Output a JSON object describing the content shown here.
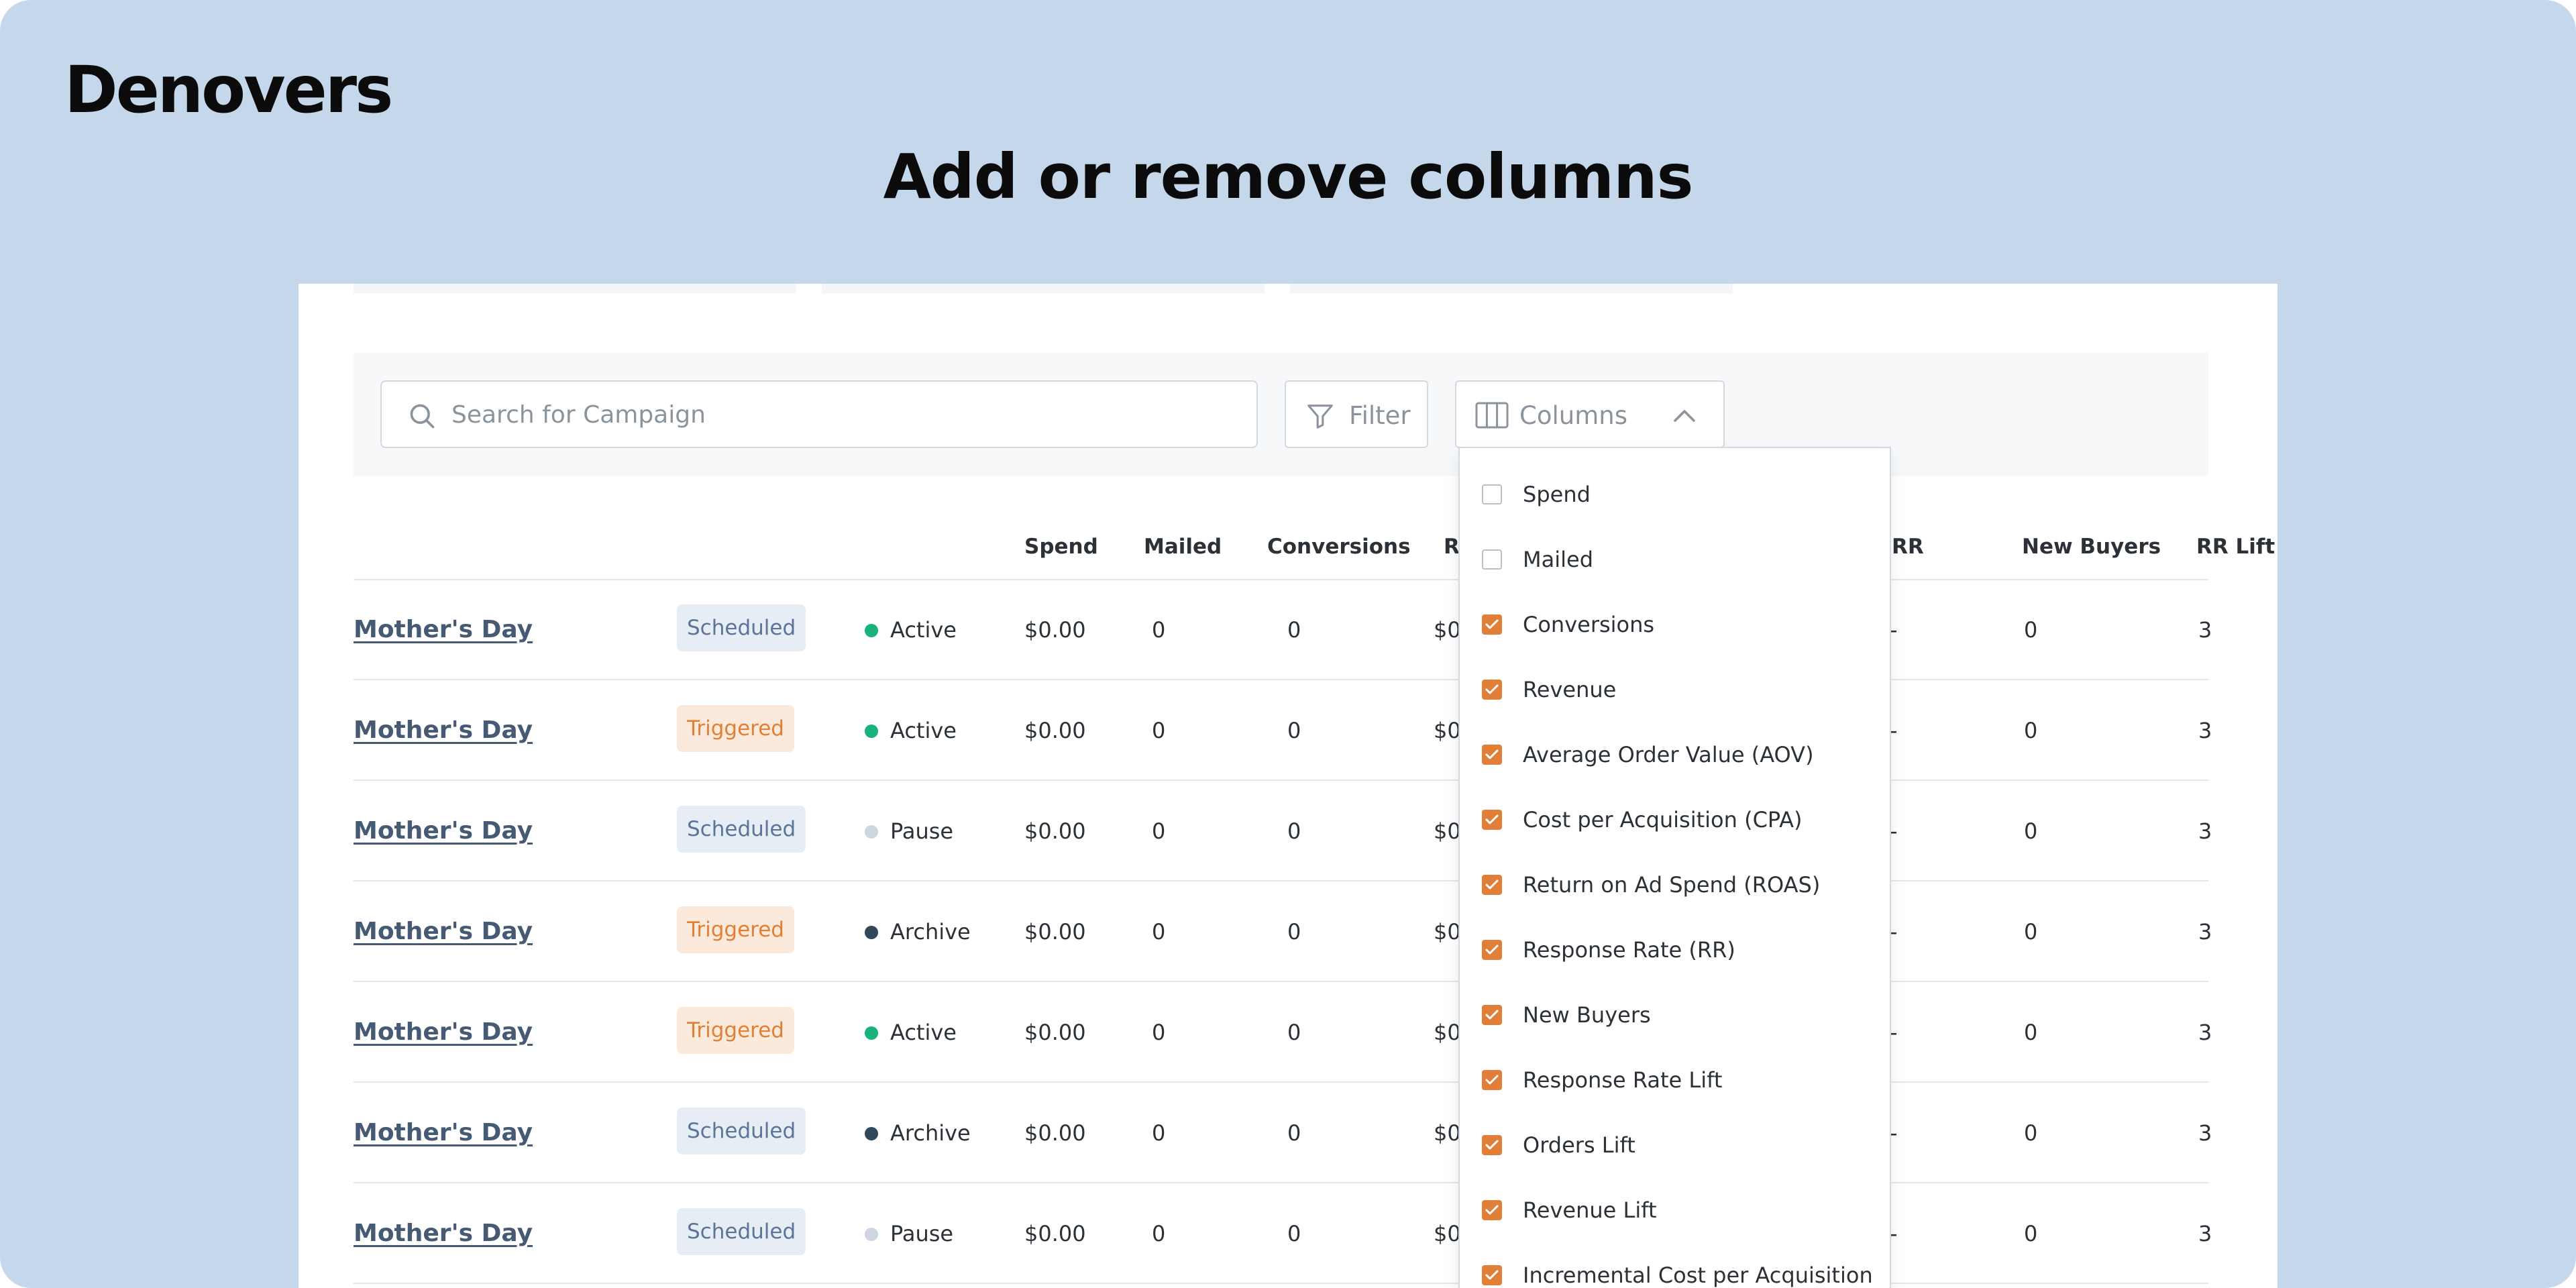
{
  "brand": {
    "logo_text": "Denovers"
  },
  "headline": "Add or remove columns",
  "toolbar": {
    "search_placeholder": "Search for Campaign",
    "filter_label": "Filter",
    "columns_label": "Columns"
  },
  "table": {
    "headers": [
      "Spend",
      "Mailed",
      "Conversions",
      "R",
      "RR",
      "New Buyers",
      "RR Lift"
    ],
    "rows": [
      {
        "name": "Mother's Day",
        "type": "Scheduled",
        "status": "Active",
        "spend": "$0.00",
        "mailed": "0",
        "conversions": "0",
        "revenue": "$0",
        "rr": "-",
        "new_buyers": "0",
        "rr_lift": "3"
      },
      {
        "name": "Mother's Day",
        "type": "Triggered",
        "status": "Active",
        "spend": "$0.00",
        "mailed": "0",
        "conversions": "0",
        "revenue": "$0",
        "rr": "-",
        "new_buyers": "0",
        "rr_lift": "3"
      },
      {
        "name": "Mother's Day",
        "type": "Scheduled",
        "status": "Pause",
        "spend": "$0.00",
        "mailed": "0",
        "conversions": "0",
        "revenue": "$0",
        "rr": "-",
        "new_buyers": "0",
        "rr_lift": "3"
      },
      {
        "name": "Mother's Day",
        "type": "Triggered",
        "status": "Archive",
        "spend": "$0.00",
        "mailed": "0",
        "conversions": "0",
        "revenue": "$0",
        "rr": "-",
        "new_buyers": "0",
        "rr_lift": "3"
      },
      {
        "name": "Mother's Day",
        "type": "Triggered",
        "status": "Active",
        "spend": "$0.00",
        "mailed": "0",
        "conversions": "0",
        "revenue": "$0",
        "rr": "-",
        "new_buyers": "0",
        "rr_lift": "3"
      },
      {
        "name": "Mother's Day",
        "type": "Scheduled",
        "status": "Archive",
        "spend": "$0.00",
        "mailed": "0",
        "conversions": "0",
        "revenue": "$0",
        "rr": "-",
        "new_buyers": "0",
        "rr_lift": "3"
      },
      {
        "name": "Mother's Day",
        "type": "Scheduled",
        "status": "Pause",
        "spend": "$0.00",
        "mailed": "0",
        "conversions": "0",
        "revenue": "$0",
        "rr": "-",
        "new_buyers": "0",
        "rr_lift": "3"
      }
    ]
  },
  "columns_menu": {
    "options": [
      {
        "label": "Spend",
        "checked": false
      },
      {
        "label": "Mailed",
        "checked": false
      },
      {
        "label": "Conversions",
        "checked": true
      },
      {
        "label": "Revenue",
        "checked": true
      },
      {
        "label": "Average Order Value (AOV)",
        "checked": true
      },
      {
        "label": "Cost per Acquisition (CPA)",
        "checked": true
      },
      {
        "label": "Return on Ad Spend (ROAS)",
        "checked": true
      },
      {
        "label": "Response Rate (RR)",
        "checked": true
      },
      {
        "label": "New Buyers",
        "checked": true
      },
      {
        "label": "Response Rate Lift",
        "checked": true
      },
      {
        "label": "Orders Lift",
        "checked": true
      },
      {
        "label": "Revenue Lift",
        "checked": true
      },
      {
        "label": "Incremental Cost per Acquisition",
        "checked": true
      }
    ]
  },
  "colors": {
    "page_bg": "#c5d7eb",
    "accent_checkbox": "#e17e37",
    "status_active": "#18b27a",
    "status_pause": "#cdd6e1",
    "status_archive": "#33475b",
    "badge_scheduled_text": "#5b7498",
    "badge_triggered_text": "#e27f35"
  },
  "icons": {
    "search": "search-icon",
    "filter": "filter-icon",
    "columns": "columns-icon",
    "chevron": "chevron-up-icon",
    "check": "check-icon"
  }
}
